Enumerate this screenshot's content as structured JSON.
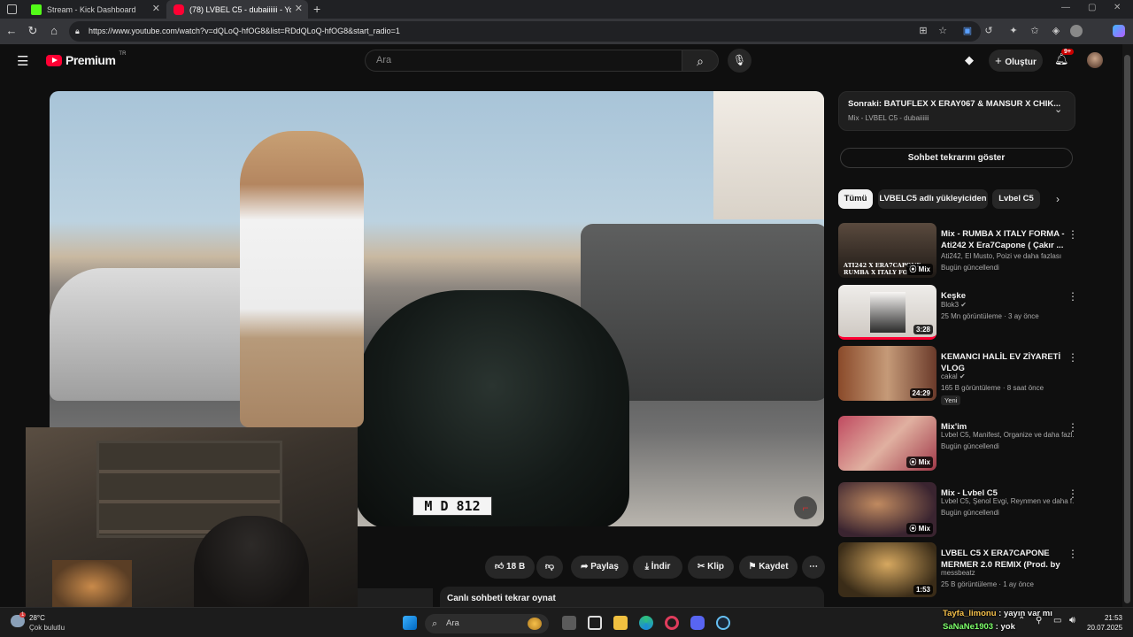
{
  "browser": {
    "tabs": [
      {
        "title": "Stream - Kick Dashboard",
        "favicon_color": "#53fc18",
        "active": false
      },
      {
        "title": "(78) LVBEL C5 - dubaiiiiii - Yo",
        "favicon_color": "#ff0033",
        "active": true
      }
    ],
    "url": "https://www.youtube.com/watch?v=dQLoQ-hfOG8&list=RDdQLoQ-hfOG8&start_radio=1"
  },
  "youtube": {
    "logo_text": "Premium",
    "region": "TR",
    "search_placeholder": "Ara",
    "create_label": "Oluştur",
    "notif_count": "9+"
  },
  "video": {
    "plate_text": "M D 812",
    "actions": {
      "likes": "18 B",
      "share": "Paylaş",
      "download": "İndir",
      "clip": "Klip",
      "save": "Kaydet"
    },
    "live_chat_replay": "Canlı sohbeti tekrar oynat"
  },
  "sidebar": {
    "next_title": "Sonraki: BATUFLEX X ERAY067 & MANSUR X CHIK...",
    "next_subtitle": "Mix - LVBEL C5 - dubaiiiiii",
    "chat_replay_button": "Sohbet tekrarını göster",
    "chips": [
      "Tümü",
      "LVBELC5 adlı yükleyiciden",
      "Lvbel C5"
    ],
    "recommendations": [
      {
        "title": "Mix - RUMBA X ITALY FORMA - Ati242 X Era7Capone ( Çakır ...",
        "channel": "Ati242, El Musto, Poizi ve daha fazlası",
        "meta": "Bugün güncellendi",
        "badge": "Mix",
        "thumb_text": "ATI242 X ERA7CAPONE RUMBA X ITALY FO",
        "color1": "#2a2a2a",
        "color2": "#8a7560"
      },
      {
        "title": "Keşke",
        "channel": "Blok3",
        "meta": "25 Mn görüntüleme · 3 ay önce",
        "badge": "3:28",
        "color1": "#e8e4e0",
        "color2": "#b9b2ab"
      },
      {
        "title": "KEMANCI HALİL EV ZİYARETİ VLOG",
        "channel": "cakal",
        "meta": "165 B görüntüleme · 8 saat önce",
        "badge": "24:29",
        "new": "Yeni",
        "color1": "#7a4a30",
        "color2": "#c49a78"
      },
      {
        "title": "Mix'im",
        "channel": "Lvbel C5, Manifest, Organize ve daha fazl...",
        "meta": "Bugün güncellendi",
        "badge": "Mix",
        "color1": "#b0425a",
        "color2": "#d8a08e"
      },
      {
        "title": "Mix - Lvbel C5",
        "channel": "Lvbel C5, Şenol Evgi, Reynmen ve daha f...",
        "meta": "Bugün güncellendi",
        "badge": "Mix",
        "color1": "#4a2f3a",
        "color2": "#9a6e58"
      },
      {
        "title": "LVBEL C5 X ERA7CAPONE MERMER 2.0 REMIX (Prod. by ...",
        "channel": "messbeatz",
        "meta": "25 B görüntüleme · 1 ay önce",
        "badge": "1:53",
        "color1": "#3a2c18",
        "color2": "#b08a48"
      }
    ]
  },
  "chat_overlay": [
    {
      "user": "Tayfa_limonu",
      "user_color": "#f6c04a",
      "text": " : yayın var mı"
    },
    {
      "user": "SaNaNe1903",
      "user_color": "#7dff6a",
      "text": " : yok"
    }
  ],
  "taskbar": {
    "weather_temp": "28°C",
    "weather_desc": "Çok bulutlu",
    "weather_badge": "1",
    "search_label": "Ara",
    "time": "21:53",
    "date": "20.07.2025"
  }
}
